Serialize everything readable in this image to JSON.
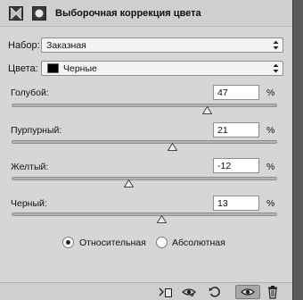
{
  "header": {
    "title": "Выборочная коррекция цвета"
  },
  "preset": {
    "label": "Набор:",
    "value": "Заказная"
  },
  "colors": {
    "label": "Цвета:",
    "value": "Черные",
    "swatch_color": "#000000"
  },
  "sliders": [
    {
      "label": "Голубой:",
      "value": "47",
      "unit": "%"
    },
    {
      "label": "Пурпурный:",
      "value": "21",
      "unit": "%"
    },
    {
      "label": "Желтый:",
      "value": "-12",
      "unit": "%"
    },
    {
      "label": "Черный:",
      "value": "13",
      "unit": "%"
    }
  ],
  "method": {
    "options": [
      "Относительная",
      "Абсолютная"
    ],
    "selected": "Относительная"
  },
  "bottom_toolbar": {
    "icons": [
      "clip-to-layer-icon",
      "view-previous-state-icon",
      "reset-icon",
      "toggle-visibility-icon",
      "delete-icon"
    ],
    "active": "toggle-visibility-icon"
  },
  "colors_theme": {
    "panel_bg": "#d6d6d6",
    "scrollbar": "#5a5a5a",
    "track": "#b4b4b4"
  }
}
